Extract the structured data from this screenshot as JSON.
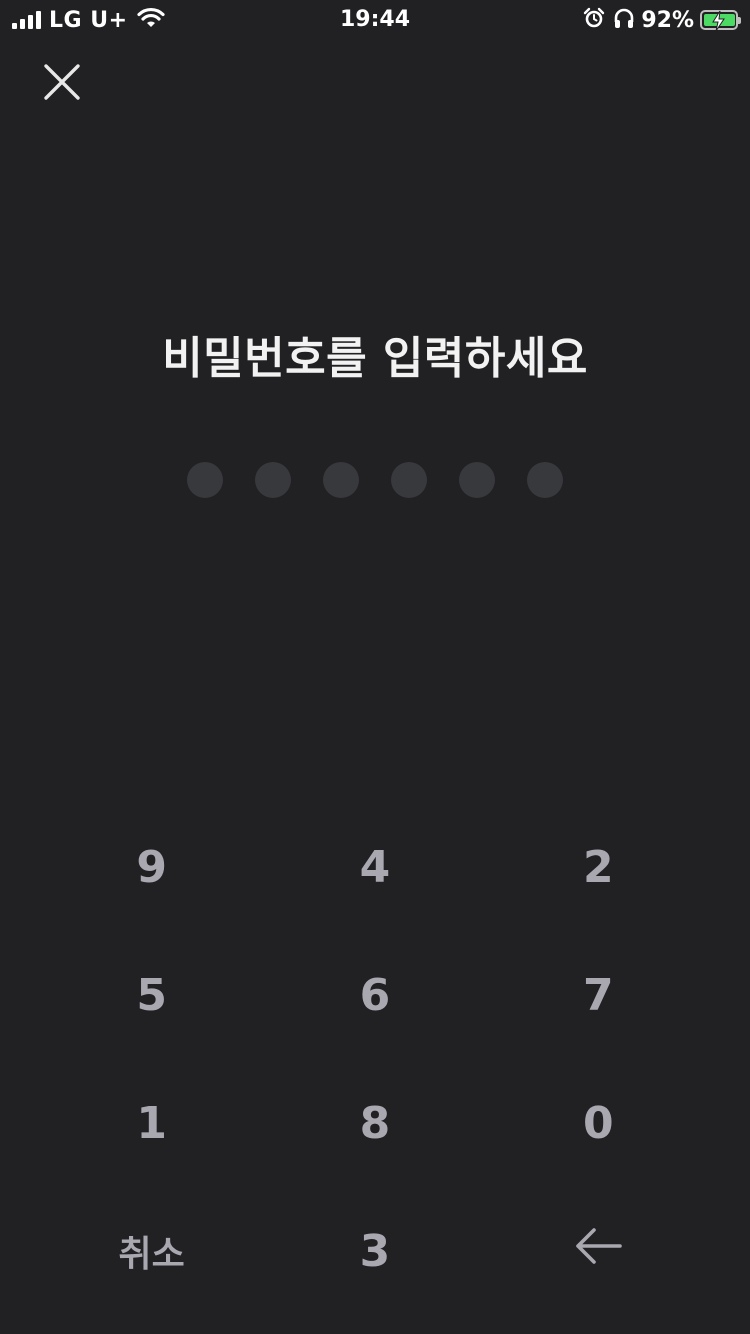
{
  "status_bar": {
    "carrier": "LG U+",
    "time": "19:44",
    "battery_percent": "92%",
    "icons": [
      "signal-icon",
      "wifi-icon",
      "alarm-icon",
      "headphones-icon",
      "battery-charging-icon"
    ],
    "battery_color": "#4cd964"
  },
  "header": {
    "close_icon": "close-icon"
  },
  "main": {
    "title": "비밀번호를 입력하세요",
    "pin_length": 6,
    "pin_filled": 0,
    "dot_color": "#38393d"
  },
  "keypad": {
    "keys": [
      "9",
      "4",
      "2",
      "5",
      "6",
      "7",
      "1",
      "8",
      "0",
      "취소",
      "3",
      "backspace-icon"
    ],
    "cancel_label": "취소",
    "key_color": "#a9a8b0"
  },
  "theme": {
    "background": "#212023",
    "text": "#f2f2f2"
  }
}
